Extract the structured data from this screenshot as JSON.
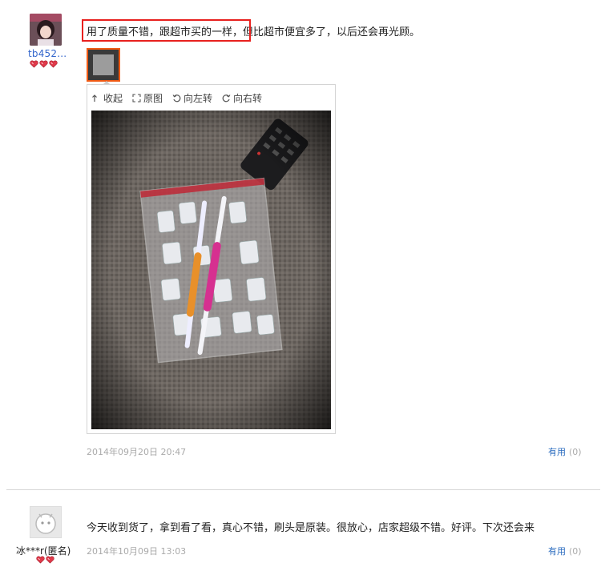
{
  "review1": {
    "username": "tb452...",
    "rating_hearts": 3,
    "text": "用了质量不错，跟超市买的一样，但比超市便宜多了，以后还会再光顾。",
    "viewer": {
      "collapse_label": "收起",
      "original_label": "原图",
      "rotate_left_label": "向左转",
      "rotate_right_label": "向右转"
    },
    "date": "2014年09月20日 20:47",
    "useful_label": "有用",
    "useful_count": "(0)"
  },
  "review2": {
    "username": "冰***r(匿名)",
    "rating_hearts": 2,
    "text": "今天收到货了，拿到看了看，真心不错，刷头是原装。很放心，店家超级不错。好评。下次还会来",
    "date": "2014年10月09日 13:03",
    "useful_label": "有用",
    "useful_count": "(0)"
  },
  "colors": {
    "link_blue": "#2a6bbf",
    "highlight_red": "#e8201e",
    "thumb_border_orange": "#f05a14",
    "muted_gray": "#aaaaaa"
  },
  "icons": [
    "collapse-icon",
    "fullscreen-icon",
    "rotate-left-icon",
    "rotate-right-icon",
    "heart-icon",
    "default-avatar-icon"
  ]
}
